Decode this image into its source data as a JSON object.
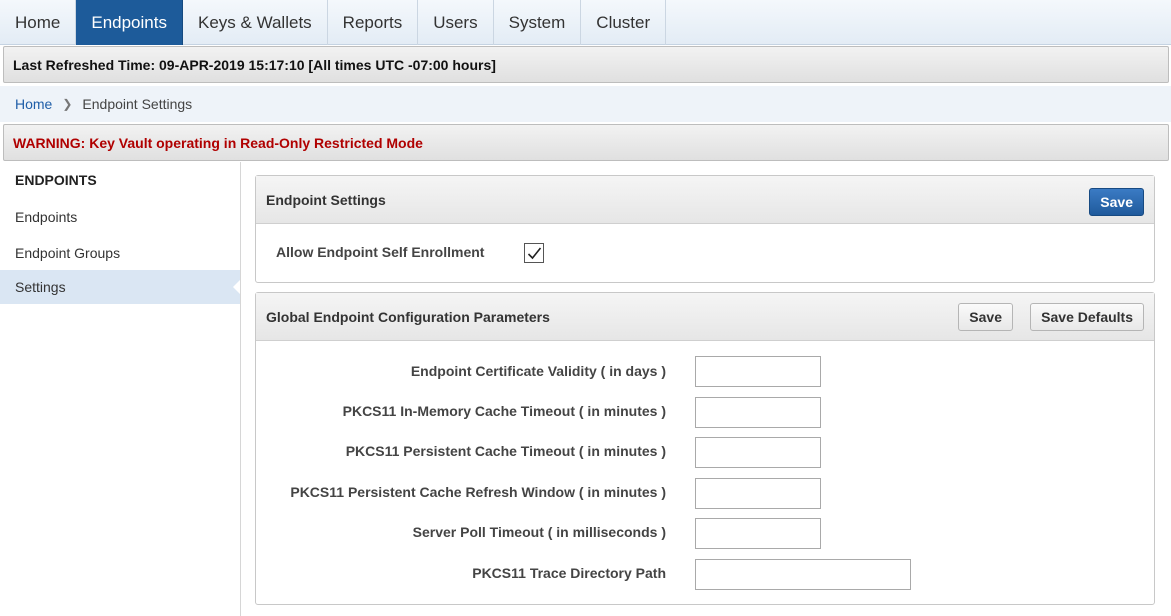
{
  "topnav": {
    "tabs": [
      {
        "label": "Home"
      },
      {
        "label": "Endpoints",
        "active": true
      },
      {
        "label": "Keys & Wallets"
      },
      {
        "label": "Reports"
      },
      {
        "label": "Users"
      },
      {
        "label": "System"
      },
      {
        "label": "Cluster"
      }
    ]
  },
  "refresh": {
    "text": "Last Refreshed Time: 09-APR-2019 15:17:10 [All times UTC -07:00 hours]"
  },
  "breadcrumb": {
    "home": "Home",
    "current": "Endpoint Settings"
  },
  "warning": {
    "text": "WARNING: Key Vault operating in Read-Only Restricted Mode"
  },
  "sidebar": {
    "heading": "ENDPOINTS",
    "items": [
      {
        "label": "Endpoints"
      },
      {
        "label": "Endpoint Groups"
      },
      {
        "label": "Settings",
        "selected": true
      }
    ]
  },
  "endpoint_settings": {
    "title": "Endpoint Settings",
    "save_label": "Save",
    "self_enrollment_label": "Allow Endpoint Self Enrollment",
    "self_enrollment_checked": true
  },
  "global_params": {
    "title": "Global Endpoint Configuration Parameters",
    "save_label": "Save",
    "save_defaults_label": "Save Defaults",
    "fields": [
      {
        "label": "Endpoint Certificate Validity ( in days )",
        "value": ""
      },
      {
        "label": "PKCS11 In-Memory Cache Timeout ( in minutes )",
        "value": ""
      },
      {
        "label": "PKCS11 Persistent Cache Timeout ( in minutes )",
        "value": ""
      },
      {
        "label": "PKCS11 Persistent Cache Refresh Window ( in minutes )",
        "value": ""
      },
      {
        "label": "Server Poll Timeout ( in milliseconds )",
        "value": ""
      },
      {
        "label": "PKCS11 Trace Directory Path",
        "value": ""
      }
    ]
  },
  "colors": {
    "nav_active": "#1d5b9a",
    "warning_text": "#b00000",
    "link": "#1f5ea8",
    "primary_button": "#2a68ad"
  }
}
